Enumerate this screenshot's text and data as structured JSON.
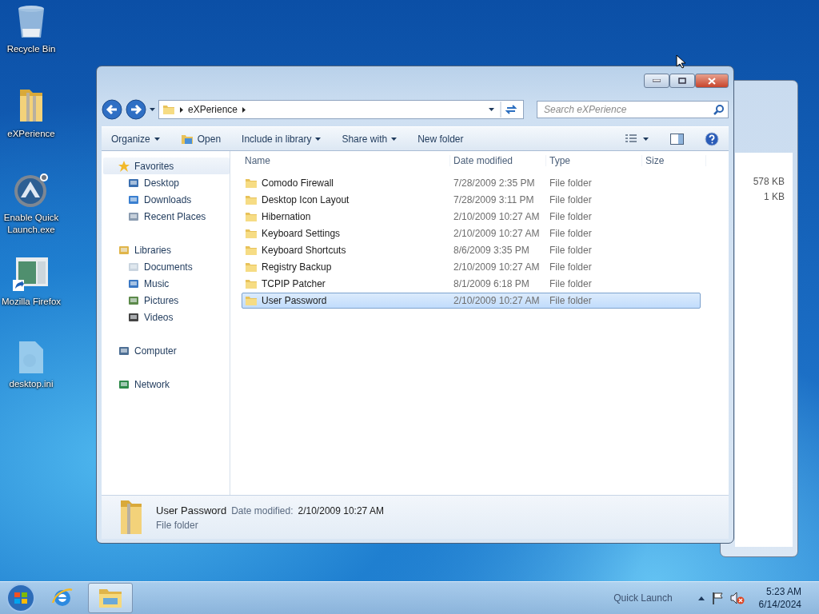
{
  "desktop_icons": [
    {
      "label": "Recycle Bin",
      "kind": "bin"
    },
    {
      "label": "eXPerience",
      "kind": "folder"
    },
    {
      "label": "Enable Quick Launch.exe",
      "kind": "app"
    },
    {
      "label": "Mozilla Firefox",
      "kind": "shortcut"
    },
    {
      "label": "desktop.ini",
      "kind": "file"
    }
  ],
  "background_window": {
    "sizes": [
      "578 KB",
      "1 KB"
    ]
  },
  "window": {
    "breadcrumb": [
      "eXPerience"
    ],
    "search": {
      "placeholder": "Search eXPerience"
    },
    "toolbar": [
      {
        "label": "Organize",
        "kind": "menu"
      },
      {
        "label": "Open",
        "kind": "open"
      },
      {
        "label": "Include in library",
        "kind": "menu"
      },
      {
        "label": "Share with",
        "kind": "menu"
      },
      {
        "label": "New folder",
        "kind": "plain"
      }
    ],
    "nav": [
      {
        "label": "Favorites",
        "kind": "star",
        "selected": true,
        "children": [
          {
            "label": "Desktop",
            "kind": "desktop",
            "selected": false
          },
          {
            "label": "Downloads",
            "kind": "downloads",
            "selected": false
          },
          {
            "label": "Recent Places",
            "kind": "recent",
            "selected": false
          }
        ]
      },
      {
        "label": "Libraries",
        "kind": "library",
        "selected": false,
        "children": [
          {
            "label": "Documents",
            "kind": "documents",
            "selected": false
          },
          {
            "label": "Music",
            "kind": "music",
            "selected": false
          },
          {
            "label": "Pictures",
            "kind": "pictures",
            "selected": false
          },
          {
            "label": "Videos",
            "kind": "videos",
            "selected": false
          }
        ]
      },
      {
        "label": "Computer",
        "kind": "computer",
        "selected": false
      },
      {
        "label": "Network",
        "kind": "network",
        "selected": false
      }
    ],
    "columns": [
      "Name",
      "Date modified",
      "Type",
      "Size"
    ],
    "rows": [
      {
        "name": "Comodo Firewall",
        "date": "7/28/2009 2:35 PM",
        "type": "File folder",
        "selected": false
      },
      {
        "name": "Desktop Icon Layout",
        "date": "7/28/2009 3:11 PM",
        "type": "File folder",
        "selected": false
      },
      {
        "name": "Hibernation",
        "date": "2/10/2009 10:27 AM",
        "type": "File folder",
        "selected": false
      },
      {
        "name": "Keyboard Settings",
        "date": "2/10/2009 10:27 AM",
        "type": "File folder",
        "selected": false
      },
      {
        "name": "Keyboard Shortcuts",
        "date": "8/6/2009 3:35 PM",
        "type": "File folder",
        "selected": false
      },
      {
        "name": "Registry Backup",
        "date": "2/10/2009 10:27 AM",
        "type": "File folder",
        "selected": false
      },
      {
        "name": "TCPIP Patcher",
        "date": "8/1/2009 6:18 PM",
        "type": "File folder",
        "selected": false
      },
      {
        "name": "User Password",
        "date": "2/10/2009 10:27 AM",
        "type": "File folder",
        "selected": true
      }
    ],
    "details": {
      "name": "User Password",
      "date_label": "Date modified:",
      "date": "2/10/2009 10:27 AM",
      "type": "File folder"
    }
  },
  "taskbar": {
    "apps": [
      {
        "kind": "browser",
        "active": false
      },
      {
        "kind": "explorer",
        "active": true
      }
    ],
    "quick_launch": "Quick Launch",
    "time": "5:23 AM",
    "date": "6/14/2024"
  }
}
